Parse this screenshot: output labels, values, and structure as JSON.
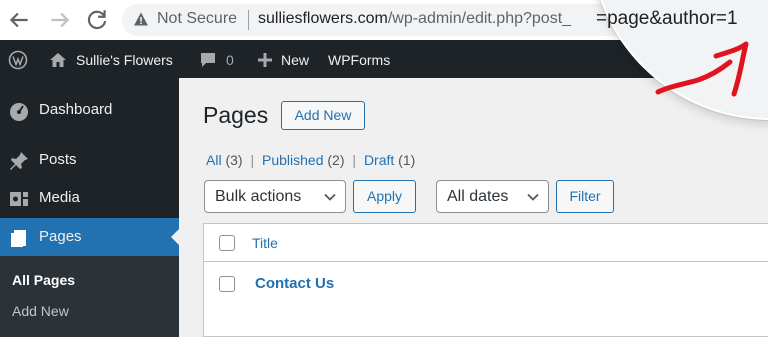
{
  "browser": {
    "security_label": "Not Secure",
    "url_domain": "sulliesflowers.com",
    "url_path": "/wp-admin/edit.php?post_",
    "magnified_url": "=page&author=1"
  },
  "admin_bar": {
    "site_name": "Sullie's Flowers",
    "comments_count": "0",
    "new_label": "New",
    "wpforms_label": "WPForms"
  },
  "sidebar": {
    "items": [
      {
        "label": "Dashboard",
        "icon": "dashboard-icon"
      },
      {
        "label": "Posts",
        "icon": "pin-icon"
      },
      {
        "label": "Media",
        "icon": "media-icon"
      },
      {
        "label": "Pages",
        "icon": "pages-icon",
        "active": true
      }
    ],
    "submenu": [
      {
        "label": "All Pages",
        "current": true
      },
      {
        "label": "Add New"
      }
    ]
  },
  "main": {
    "title": "Pages",
    "add_new_label": "Add New",
    "filters": {
      "all": "All",
      "all_count": "(3)",
      "published": "Published",
      "published_count": "(2)",
      "draft": "Draft",
      "draft_count": "(1)",
      "separator": "|"
    },
    "bulk_actions": "Bulk actions",
    "apply_label": "Apply",
    "dates": "All dates",
    "filter_label": "Filter",
    "table": {
      "column_title": "Title",
      "rows": [
        {
          "title": "Contact Us"
        }
      ]
    }
  },
  "colors": {
    "accent": "#2271b1",
    "admin_dark": "#1d2327",
    "annotation": "#e0141e"
  }
}
